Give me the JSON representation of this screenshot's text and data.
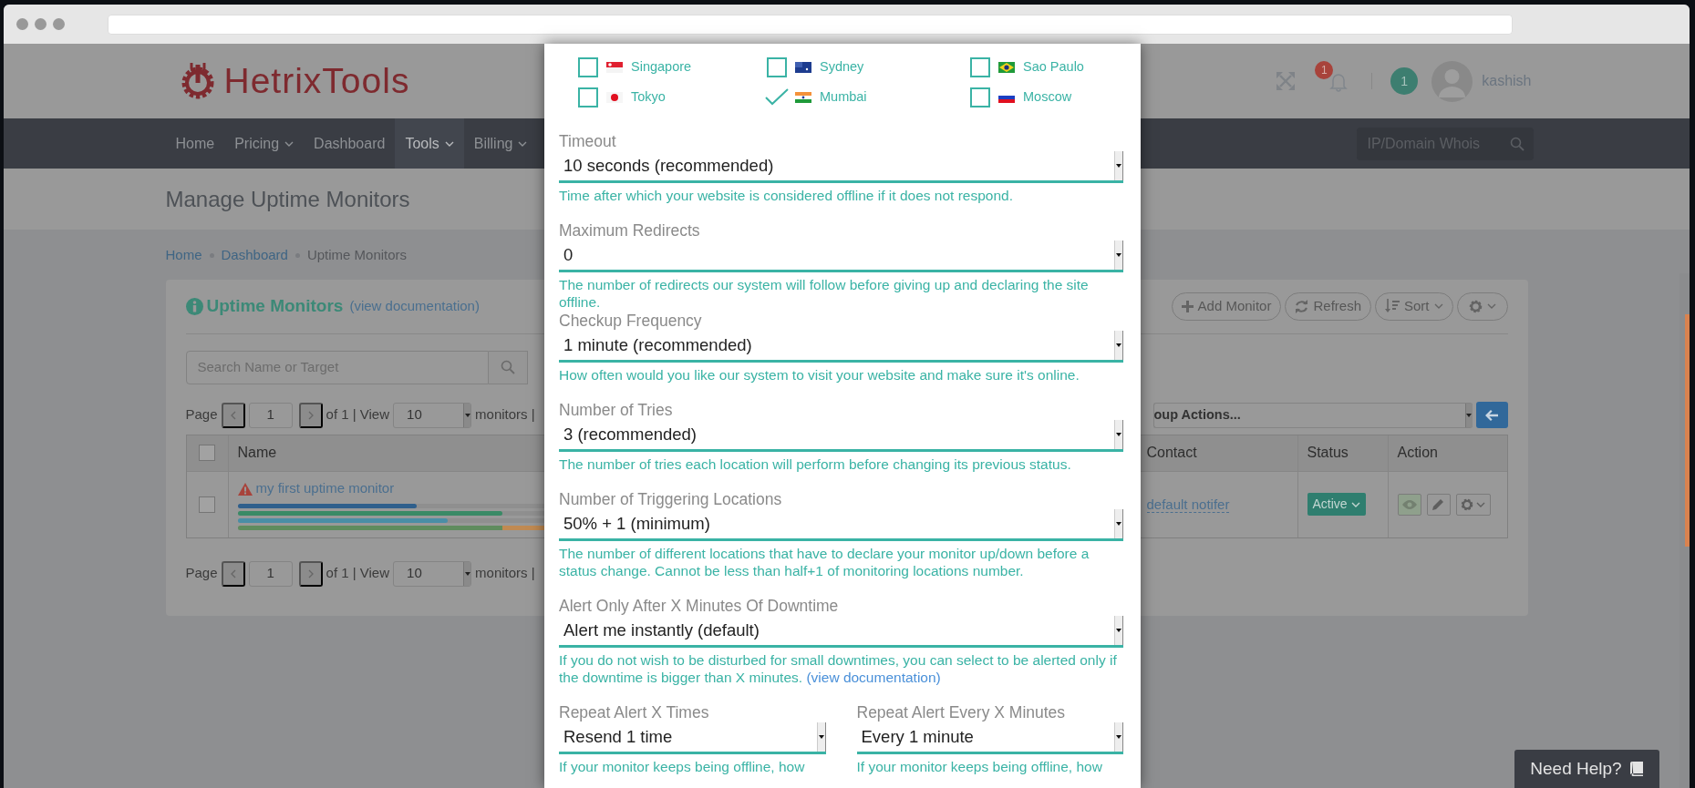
{
  "header": {
    "logo": "HetrixTools",
    "notifications_badge": "1",
    "messages_badge": "1",
    "username": "kashish"
  },
  "nav": {
    "items": [
      {
        "label": "Home",
        "dropdown": false,
        "selected": false
      },
      {
        "label": "Pricing",
        "dropdown": true,
        "selected": false
      },
      {
        "label": "Dashboard",
        "dropdown": false,
        "selected": false
      },
      {
        "label": "Tools",
        "dropdown": true,
        "selected": true
      },
      {
        "label": "Billing",
        "dropdown": true,
        "selected": false
      }
    ],
    "search": {
      "placeholder": "IP/Domain Whois"
    }
  },
  "page_title": "Manage Uptime Monitors",
  "breadcrumb": [
    {
      "label": "Home",
      "link": true
    },
    {
      "label": "Dashboard",
      "link": true
    },
    {
      "label": "Uptime Monitors",
      "link": false
    }
  ],
  "panel": {
    "title": "Uptime Monitors",
    "doc_link": "(view documentation)",
    "buttons": [
      {
        "label": "Add Monitor",
        "caret": false
      },
      {
        "label": "Refresh",
        "caret": false
      },
      {
        "label": "Sort",
        "caret": true
      },
      {
        "caret": true
      }
    ],
    "search": {
      "placeholder": "Search Name or Target"
    },
    "pagination_top": {
      "page_label": "Page",
      "page": "1",
      "of_text": "of 1 | View",
      "per_page": "10",
      "after": "monitors |"
    },
    "group_actions": "oup Actions...",
    "table": {
      "header_checked": false,
      "columns": [
        "Name",
        "Contact",
        "Status",
        "Action"
      ],
      "rows": [
        {
          "selected": false,
          "warning": true,
          "name": "my first uptime monitor",
          "contact": "default notifer",
          "status": "Active",
          "bars": [
            {
              "segments": [
                {
                  "color": "#2f5f8c",
                  "level": 0.49
                }
              ]
            },
            {
              "segments": [
                {
                  "color": "#3a8a66",
                  "level": 0.725
                }
              ]
            },
            {
              "segments": [
                {
                  "color": "#4a8ea6",
                  "level": 0.575
                }
              ]
            },
            {
              "segments": [
                {
                  "color": "#5f8c5e",
                  "level": 0.725
                },
                {
                  "color": "#c08a52",
                  "level": 0.275
                }
              ]
            }
          ]
        }
      ]
    },
    "pagination_bottom": {
      "page_label": "Page",
      "page": "1",
      "of_text": "of 1 | View",
      "per_page": "10",
      "after": "monitors |"
    }
  },
  "modal": {
    "locations": [
      {
        "name": "Singapore",
        "checked": false
      },
      {
        "name": "Sydney",
        "checked": false
      },
      {
        "name": "Sao Paulo",
        "checked": false
      },
      {
        "name": "Tokyo",
        "checked": false
      },
      {
        "name": "Mumbai",
        "checked": true
      },
      {
        "name": "Moscow",
        "checked": false
      }
    ],
    "fields": [
      {
        "label": "Timeout",
        "value": "10 seconds (recommended)",
        "help": "Time after which your website is considered offline if it does not respond."
      },
      {
        "label": "Maximum Redirects",
        "value": "0",
        "help": "The number of redirects our system will follow before giving up and declaring the site offline."
      },
      {
        "label": "Checkup Frequency",
        "value": "1 minute (recommended)",
        "help": "How often would you like our system to visit your website and make sure it's online."
      },
      {
        "label": "Number of Tries",
        "value": "3 (recommended)",
        "help": "The number of tries each location will perform before changing its previous status."
      },
      {
        "label": "Number of Triggering Locations",
        "value": "50% + 1 (minimum)",
        "help": "The number of different locations that have to declare your monitor up/down before a status change. Cannot be less than half+1 of monitoring locations number."
      },
      {
        "label": "Alert Only After X Minutes Of Downtime",
        "value": "Alert me instantly (default)",
        "help": "If you do not wish to be disturbed for small downtimes, you can select to be alerted only if the downtime is bigger than X minutes.",
        "help_link": "(view documentation)"
      }
    ],
    "half_fields": [
      {
        "label": "Repeat Alert X Times",
        "value": "Resend 1 time",
        "help": "If your monitor keeps being offline, how"
      },
      {
        "label": "Repeat Alert Every X Minutes",
        "value": "Every 1 minute",
        "help": "If your monitor keeps being offline, how"
      }
    ]
  },
  "need_help": "Need Help?"
}
